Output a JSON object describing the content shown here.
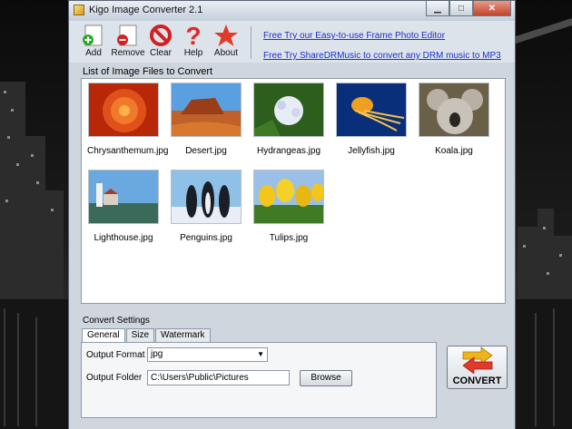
{
  "window": {
    "title": "Kigo Image Converter 2.1"
  },
  "window_controls": {
    "minimize": "▁",
    "maximize": "□",
    "close": "✕"
  },
  "toolbar": {
    "buttons": [
      {
        "label": "Add",
        "icon": "add-icon"
      },
      {
        "label": "Remove",
        "icon": "remove-icon"
      },
      {
        "label": "Clear",
        "icon": "clear-icon"
      },
      {
        "label": "Help",
        "icon": "help-icon"
      },
      {
        "label": "About",
        "icon": "about-icon"
      }
    ],
    "links": [
      "Free Try our Easy-to-use Frame Photo Editor",
      "Free Try ShareDRMusic to convert any DRM music to MP3"
    ]
  },
  "file_list": {
    "label": "List of Image Files to Convert",
    "items": [
      {
        "name": "Chrysanthemum.jpg"
      },
      {
        "name": "Desert.jpg"
      },
      {
        "name": "Hydrangeas.jpg"
      },
      {
        "name": "Jellyfish.jpg"
      },
      {
        "name": "Koala.jpg"
      },
      {
        "name": "Lighthouse.jpg"
      },
      {
        "name": "Penguins.jpg"
      },
      {
        "name": "Tulips.jpg"
      }
    ]
  },
  "settings": {
    "legend": "Convert Settings",
    "tabs": [
      "General",
      "Size",
      "Watermark"
    ],
    "active_tab": "General",
    "output_format_label": "Output Format",
    "output_format_value": "jpg",
    "output_folder_label": "Output Folder",
    "output_folder_value": "C:\\Users\\Public\\Pictures",
    "browse_label": "Browse"
  },
  "convert": {
    "label": "CONVERT"
  },
  "colors": {
    "link": "#1a33c8",
    "window": "#cfd6de",
    "accent_red": "#d32020",
    "accent_yellow": "#f0b41a"
  }
}
